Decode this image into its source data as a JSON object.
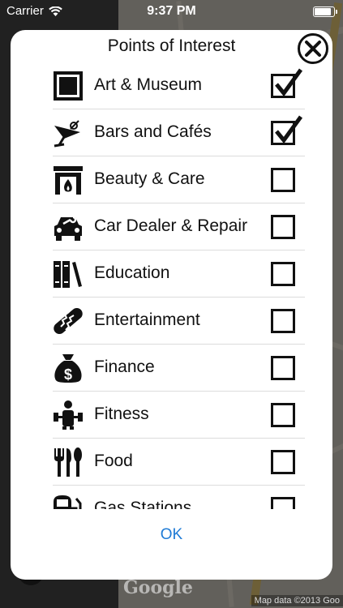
{
  "status_bar": {
    "carrier": "Carrier",
    "time": "9:37 PM"
  },
  "modal": {
    "title": "Points of Interest",
    "ok_label": "OK",
    "items": [
      {
        "label": "Art & Museum",
        "icon": "frame-icon",
        "checked": true
      },
      {
        "label": "Bars and Cafés",
        "icon": "cocktail-icon",
        "checked": true
      },
      {
        "label": "Beauty & Care",
        "icon": "fireplace-icon",
        "checked": false
      },
      {
        "label": "Car Dealer & Repair",
        "icon": "car-wrench-icon",
        "checked": false
      },
      {
        "label": "Education",
        "icon": "books-icon",
        "checked": false
      },
      {
        "label": "Entertainment",
        "icon": "hotdog-icon",
        "checked": false
      },
      {
        "label": "Finance",
        "icon": "money-bag-icon",
        "checked": false
      },
      {
        "label": "Fitness",
        "icon": "weightlifter-icon",
        "checked": false
      },
      {
        "label": "Food",
        "icon": "cutlery-icon",
        "checked": false
      },
      {
        "label": "Gas Stations",
        "icon": "gas-pump-icon",
        "checked": false
      }
    ]
  },
  "map": {
    "logo": "Google",
    "attribution": "Map data ©2013 Goo"
  },
  "colors": {
    "accent": "#1f7bd6",
    "overlay": "#000000"
  }
}
